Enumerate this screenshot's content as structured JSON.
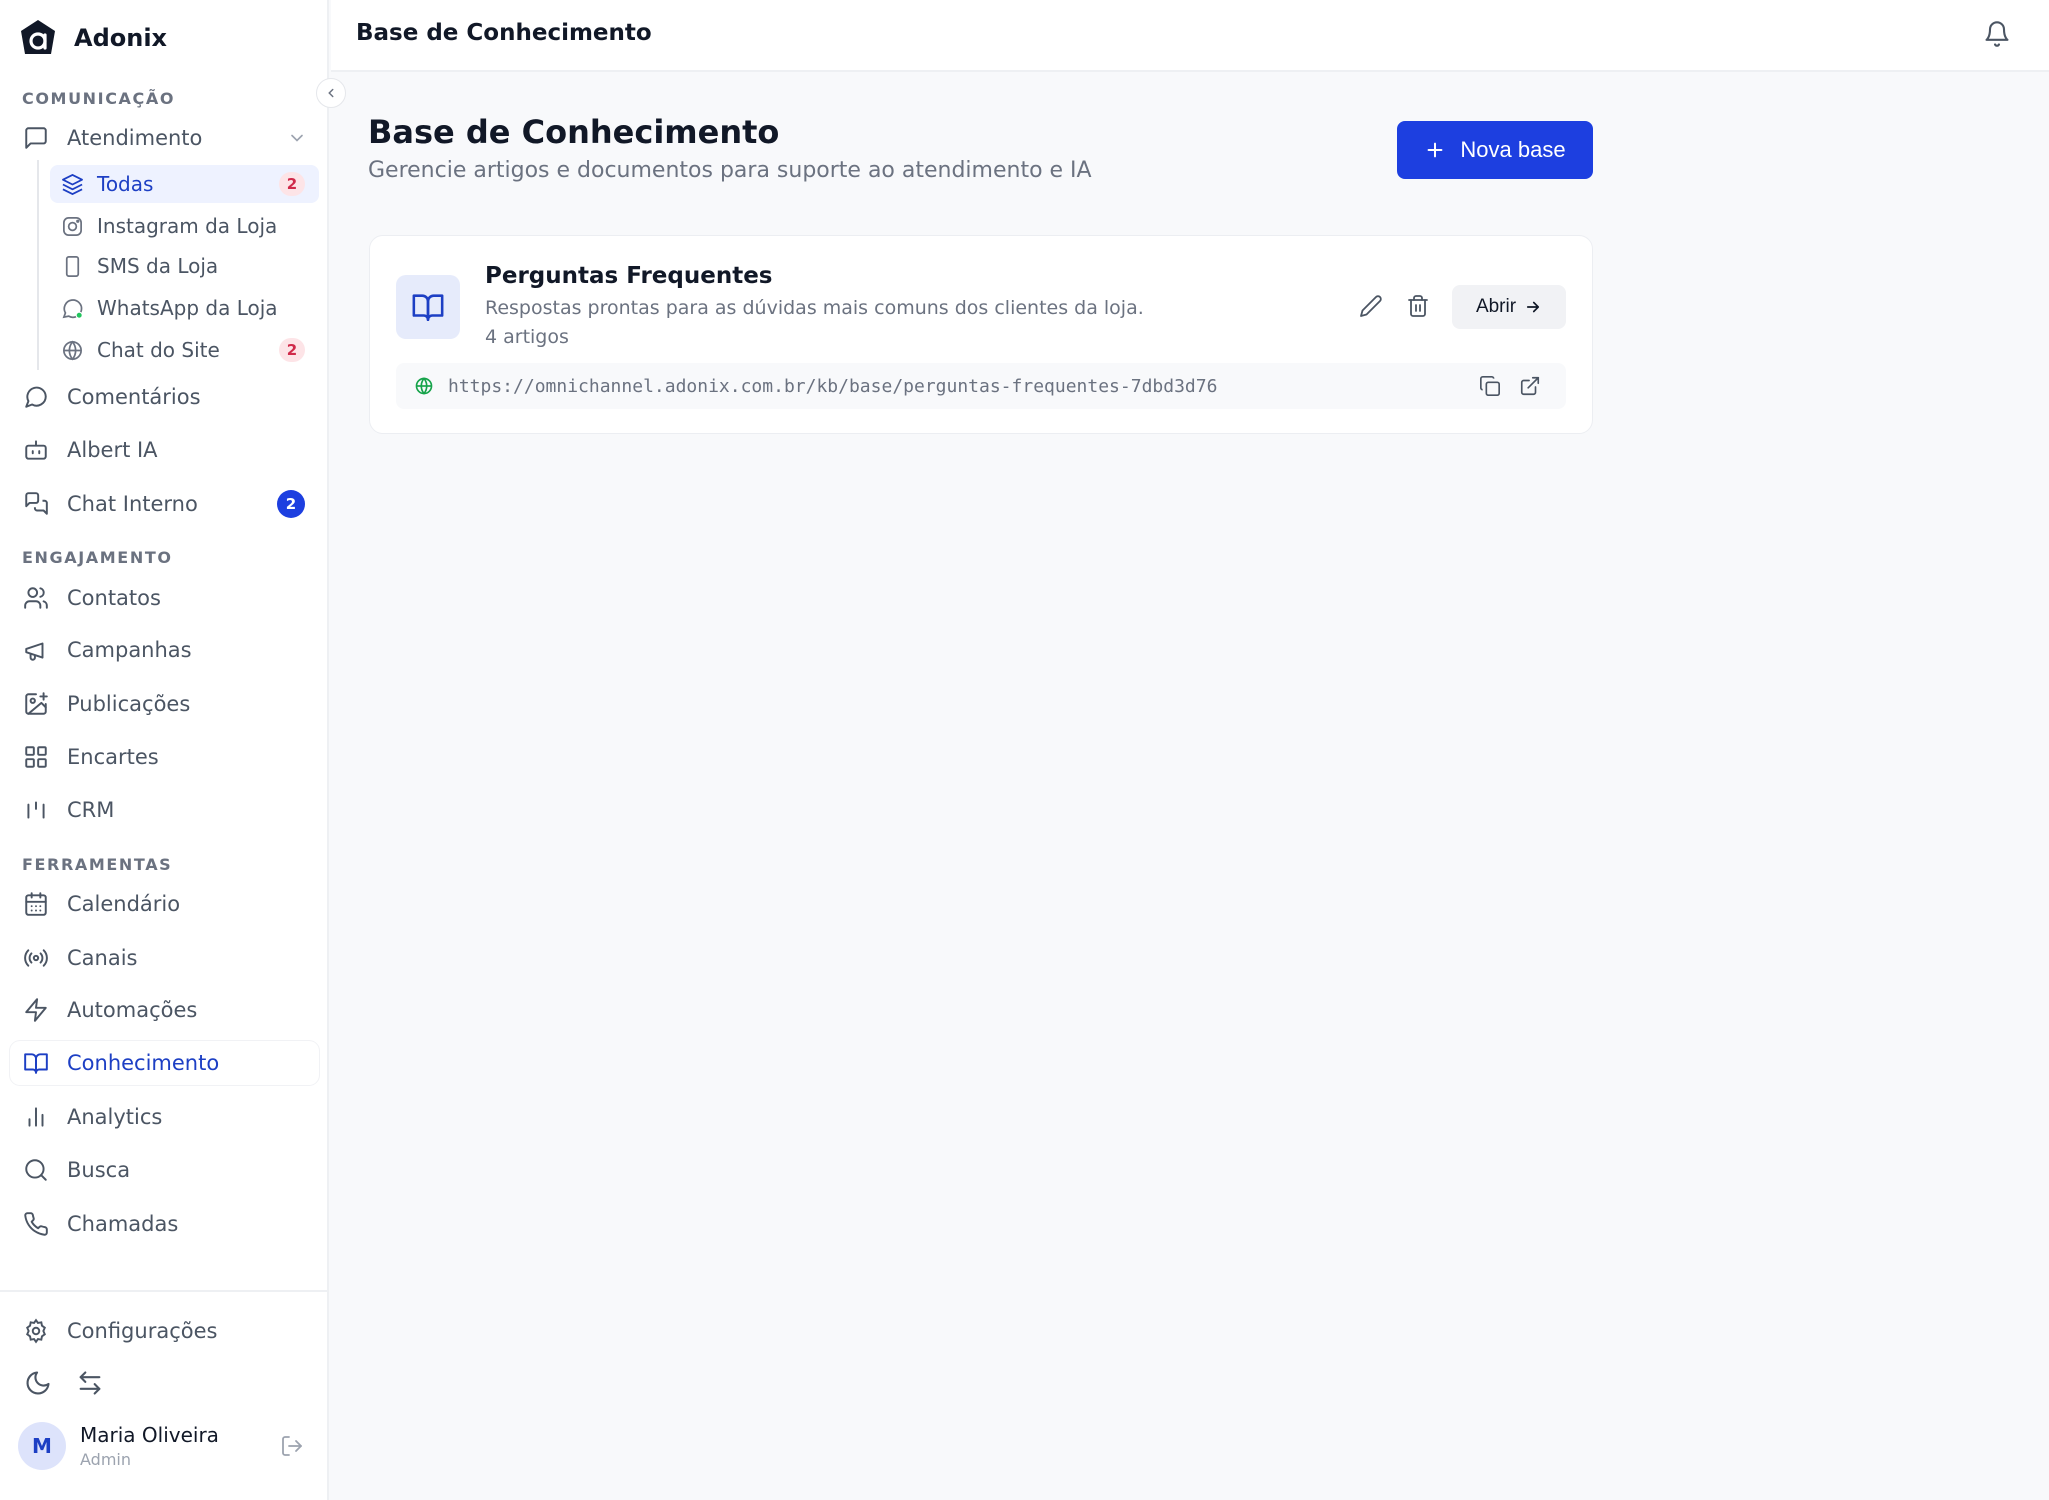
{
  "app": {
    "name": "Adonix"
  },
  "sidebar": {
    "sections": {
      "comunicacao": "COMUNICAÇÃO",
      "engajamento": "ENGAJAMENTO",
      "ferramentas": "FERRAMENTAS"
    },
    "atendimento": {
      "label": "Atendimento",
      "subitems": [
        {
          "label": "Todas",
          "badge": "2"
        },
        {
          "label": "Instagram da Loja"
        },
        {
          "label": "SMS da Loja"
        },
        {
          "label": "WhatsApp da Loja"
        },
        {
          "label": "Chat do Site",
          "badge": "2"
        }
      ]
    },
    "comunicacao_items": [
      {
        "label": "Comentários"
      },
      {
        "label": "Albert IA"
      },
      {
        "label": "Chat Interno",
        "badge": "2"
      }
    ],
    "engajamento_items": [
      {
        "label": "Contatos"
      },
      {
        "label": "Campanhas"
      },
      {
        "label": "Publicações"
      },
      {
        "label": "Encartes"
      },
      {
        "label": "CRM"
      }
    ],
    "ferramentas_items": [
      {
        "label": "Calendário"
      },
      {
        "label": "Canais"
      },
      {
        "label": "Automações"
      },
      {
        "label": "Conhecimento",
        "active": true
      },
      {
        "label": "Analytics"
      },
      {
        "label": "Busca"
      },
      {
        "label": "Chamadas"
      }
    ],
    "settings_label": "Configurações",
    "user": {
      "initial": "M",
      "name": "Maria Oliveira",
      "role": "Admin"
    }
  },
  "header": {
    "title": "Base de Conhecimento"
  },
  "main": {
    "title": "Base de Conhecimento",
    "subtitle": "Gerencie artigos e documentos para suporte ao atendimento e IA",
    "new_button": "Nova base",
    "bases": [
      {
        "title": "Perguntas Frequentes",
        "description": "Respostas prontas para as dúvidas mais comuns dos clientes da loja.",
        "count": "4 artigos",
        "open_label": "Abrir",
        "url": "https://omnichannel.adonix.com.br/kb/base/perguntas-frequentes-7dbd3d76"
      }
    ]
  },
  "colors": {
    "accent": "#1d3fe0",
    "active_text": "#1d3fc4",
    "badge_red_bg": "#fde4e7",
    "badge_red_text": "#d02a4a",
    "url_globe": "#16a34a"
  }
}
